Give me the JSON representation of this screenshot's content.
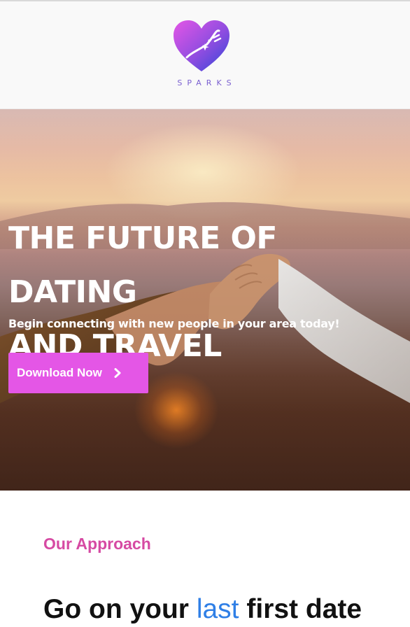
{
  "brand": {
    "name": "SPARKS",
    "colors": {
      "gradient_start": "#e456e6",
      "gradient_end": "#2f46d8"
    }
  },
  "hero": {
    "title_line1": "THE FUTURE OF DATING",
    "title_line2": "AND TRAVEL",
    "subtitle": "Begin connecting with new people in your area today!",
    "button_label": "Download Now",
    "button_icon": "chevron-right-icon",
    "button_color": "#e456e6"
  },
  "approach": {
    "label": "Our Approach",
    "heading_before": "Go on your ",
    "heading_highlight": "last",
    "heading_after": " first date",
    "label_color": "#d64aa3",
    "highlight_color": "#2f7fe6"
  }
}
